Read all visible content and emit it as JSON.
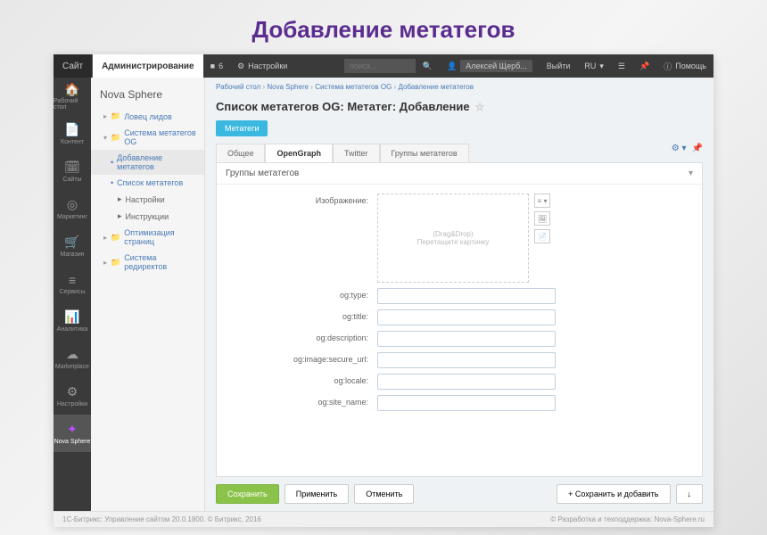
{
  "page_title": "Добавление метатегов",
  "topbar": {
    "site": "Сайт",
    "admin": "Администрирование",
    "updates": "6",
    "settings": "Настройки",
    "search_placeholder": "поиск...",
    "user": "Алексей Щерб...",
    "logout": "Выйти",
    "lang": "RU",
    "help": "Помощь"
  },
  "rail": [
    {
      "label": "Рабочий стол"
    },
    {
      "label": "Контент"
    },
    {
      "label": "Сайты"
    },
    {
      "label": "Маркетинг"
    },
    {
      "label": "Магазин"
    },
    {
      "label": "Сервисы"
    },
    {
      "label": "Аналитика"
    },
    {
      "label": "Marketplace"
    },
    {
      "label": "Настройки"
    },
    {
      "label": "Nova Sphere"
    }
  ],
  "sidebar": {
    "title": "Nova Sphere",
    "items": {
      "leads": "Ловец лидов",
      "og_system": "Система метатегов OG",
      "add_meta": "Добавление метатегов",
      "list_meta": "Список метатегов",
      "settings": "Настройки",
      "instructions": "Инструкции",
      "optimization": "Оптимизация страниц",
      "redirects": "Система редиректов"
    }
  },
  "breadcrumb": {
    "p1": "Рабочий стол",
    "p2": "Nova Sphere",
    "p3": "Система метатегов OG",
    "p4": "Добавление метатегов"
  },
  "heading": "Список метатегов OG: Метатег: Добавление",
  "metatag_btn": "Метатеги",
  "tabs": {
    "general": "Общее",
    "opengraph": "OpenGraph",
    "twitter": "Twitter",
    "groups": "Группы метатегов"
  },
  "section_title": "Группы метатегов",
  "form": {
    "image_label": "Изображение:",
    "dragdrop": "(Drag&Drop)",
    "dragdrop_hint": "Перетащите картинку",
    "og_type": "og:type:",
    "og_title": "og:title:",
    "og_description": "og:description:",
    "og_image_secure": "og:image:secure_url:",
    "og_locale": "og:locale:",
    "og_site_name": "og:site_name:"
  },
  "buttons": {
    "save": "Сохранить",
    "apply": "Применить",
    "cancel": "Отменить",
    "save_add": "Сохранить и добавить"
  },
  "footer": {
    "left": "1С-Битрикс: Управление сайтом 20.0.1800. © Битрикс, 2016",
    "right": "© Разработка и техподдержка: Nova-Sphere.ru"
  }
}
